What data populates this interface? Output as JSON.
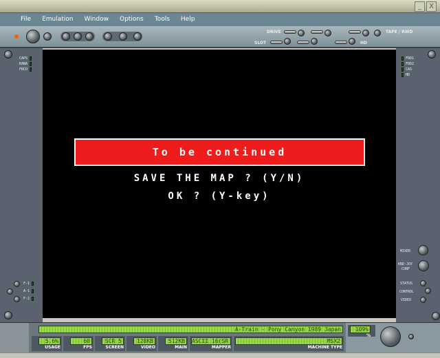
{
  "window": {
    "minimize": "_",
    "close": "X"
  },
  "menu": [
    "File",
    "Emulation",
    "Window",
    "Options",
    "Tools",
    "Help"
  ],
  "toolbar": {
    "drive_label": "DRIVE",
    "slot_label": "SLOT",
    "tape_label": "TAPE / RWD",
    "hd_label": "HD"
  },
  "left_leds": [
    "CAPS",
    "KANA",
    "FRCO"
  ],
  "left_bottom_leds": [
    "F-1",
    "A-1",
    "F-2"
  ],
  "right_leds": [
    "FDD1",
    "FDD2",
    "CAS",
    "HD"
  ],
  "right_controls": {
    "mixer": "MIXER",
    "kbd": "KBD-JOY",
    "conf": "CONF",
    "status": "STATUS",
    "control": "CONTROL",
    "video": "VIDEO"
  },
  "screen": {
    "banner": "To be continued",
    "line1": "SAVE THE MAP ? (Y/N)",
    "line2": "OK ? (Y-key)",
    "banner_color": "#ee1c1c"
  },
  "status": {
    "game": "A-Train - Pony Canyon 1989 Japan",
    "usage": "5.6%",
    "usage_label": "USAGE",
    "fps": "60",
    "fps_label": "FPS",
    "screen": "SCR 5",
    "screen_label": "SCREEN",
    "video": "128KB",
    "video_label": "VIDEO",
    "main": "512KB",
    "main_label": "MAIN",
    "mapper": "ASCII 16(SR",
    "mapper_label": "MAPPER",
    "machine": "MSX2",
    "machine_label": "MACHINE TYPE",
    "speed": "109%",
    "speed_label": "%"
  }
}
